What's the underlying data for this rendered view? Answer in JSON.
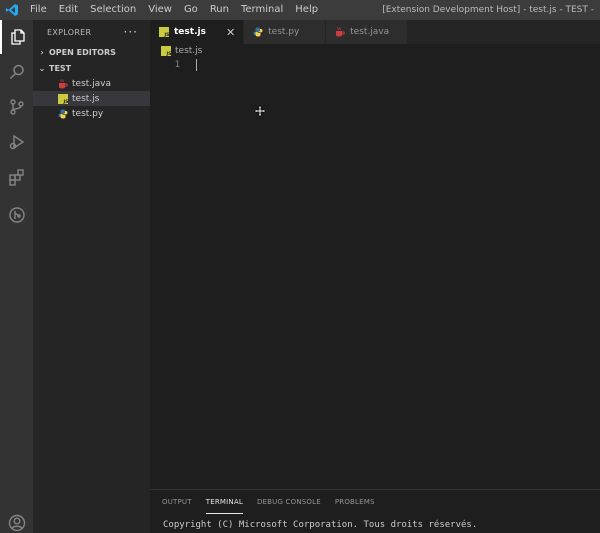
{
  "menu": [
    "File",
    "Edit",
    "Selection",
    "View",
    "Go",
    "Run",
    "Terminal",
    "Help"
  ],
  "window_title": "[Extension Development Host] - test.js - TEST -",
  "explorer": {
    "title": "EXPLORER",
    "more": "···",
    "open_editors": "OPEN EDITORS",
    "folder": "TEST",
    "files": [
      "test.java",
      "test.js",
      "test.py"
    ]
  },
  "tabs": [
    "test.js",
    "test.py",
    "test.java"
  ],
  "tab_close": "✕",
  "breadcrumb": "test.js",
  "editor": {
    "line_number": "1"
  },
  "panel": {
    "tabs": [
      "OUTPUT",
      "TERMINAL",
      "DEBUG CONSOLE",
      "PROBLEMS"
    ],
    "terminal_text": "Copyright (C) Microsoft Corporation. Tous droits réservés."
  },
  "colors": {
    "accent": "#007acc",
    "js_icon": "#cbcb41",
    "java_icon": "#cc3e44",
    "python_blue": "#3572a5",
    "python_yellow": "#f1d44b"
  }
}
